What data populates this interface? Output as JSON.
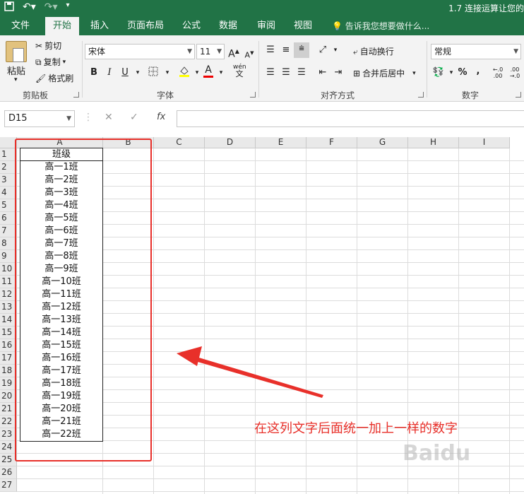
{
  "title_bar": {
    "doc_title": "1.7 连接运算让您的"
  },
  "tabs": [
    "文件",
    "开始",
    "插入",
    "页面布局",
    "公式",
    "数据",
    "审阅",
    "视图"
  ],
  "active_tab": "开始",
  "tell_me": "告诉我您想要做什么...",
  "clipboard": {
    "paste": "粘贴",
    "cut": "剪切",
    "copy": "复制",
    "format_painter": "格式刷",
    "label": "剪贴板"
  },
  "font": {
    "name": "宋体",
    "size": "11",
    "label": "字体",
    "bold": "B",
    "italic": "I",
    "underline": "U",
    "phonetic": "wén",
    "grow": "A",
    "shrink": "A"
  },
  "alignment": {
    "wrap": "自动换行",
    "merge": "合并后居中",
    "label": "对齐方式"
  },
  "number": {
    "format": "常规",
    "label": "数字",
    "percent": "%",
    "comma": ","
  },
  "formula_bar": {
    "name_box": "D15",
    "cancel": "✕",
    "enter": "✓",
    "fx": "fx",
    "value": ""
  },
  "columns": [
    "A",
    "B",
    "C",
    "D",
    "E",
    "F",
    "G",
    "H",
    "I"
  ],
  "rows": [
    "1",
    "2",
    "3",
    "4",
    "5",
    "6",
    "7",
    "8",
    "9",
    "10",
    "11",
    "12",
    "13",
    "14",
    "15",
    "16",
    "17",
    "18",
    "19",
    "20",
    "21",
    "22",
    "23",
    "24",
    "25",
    "26",
    "27"
  ],
  "column_a": [
    "班级",
    "高一1班",
    "高一2班",
    "高一3班",
    "高一4班",
    "高一5班",
    "高一6班",
    "高一7班",
    "高一8班",
    "高一9班",
    "高一10班",
    "高一11班",
    "高一12班",
    "高一13班",
    "高一14班",
    "高一15班",
    "高一16班",
    "高一17班",
    "高一18班",
    "高一19班",
    "高一20班",
    "高一21班",
    "高一22班"
  ],
  "annotation": "在这列文字后面统一加上一样的数字",
  "watermark": "Baidu",
  "colors": {
    "excel_green": "#217346",
    "annotation_red": "#e8302a"
  }
}
